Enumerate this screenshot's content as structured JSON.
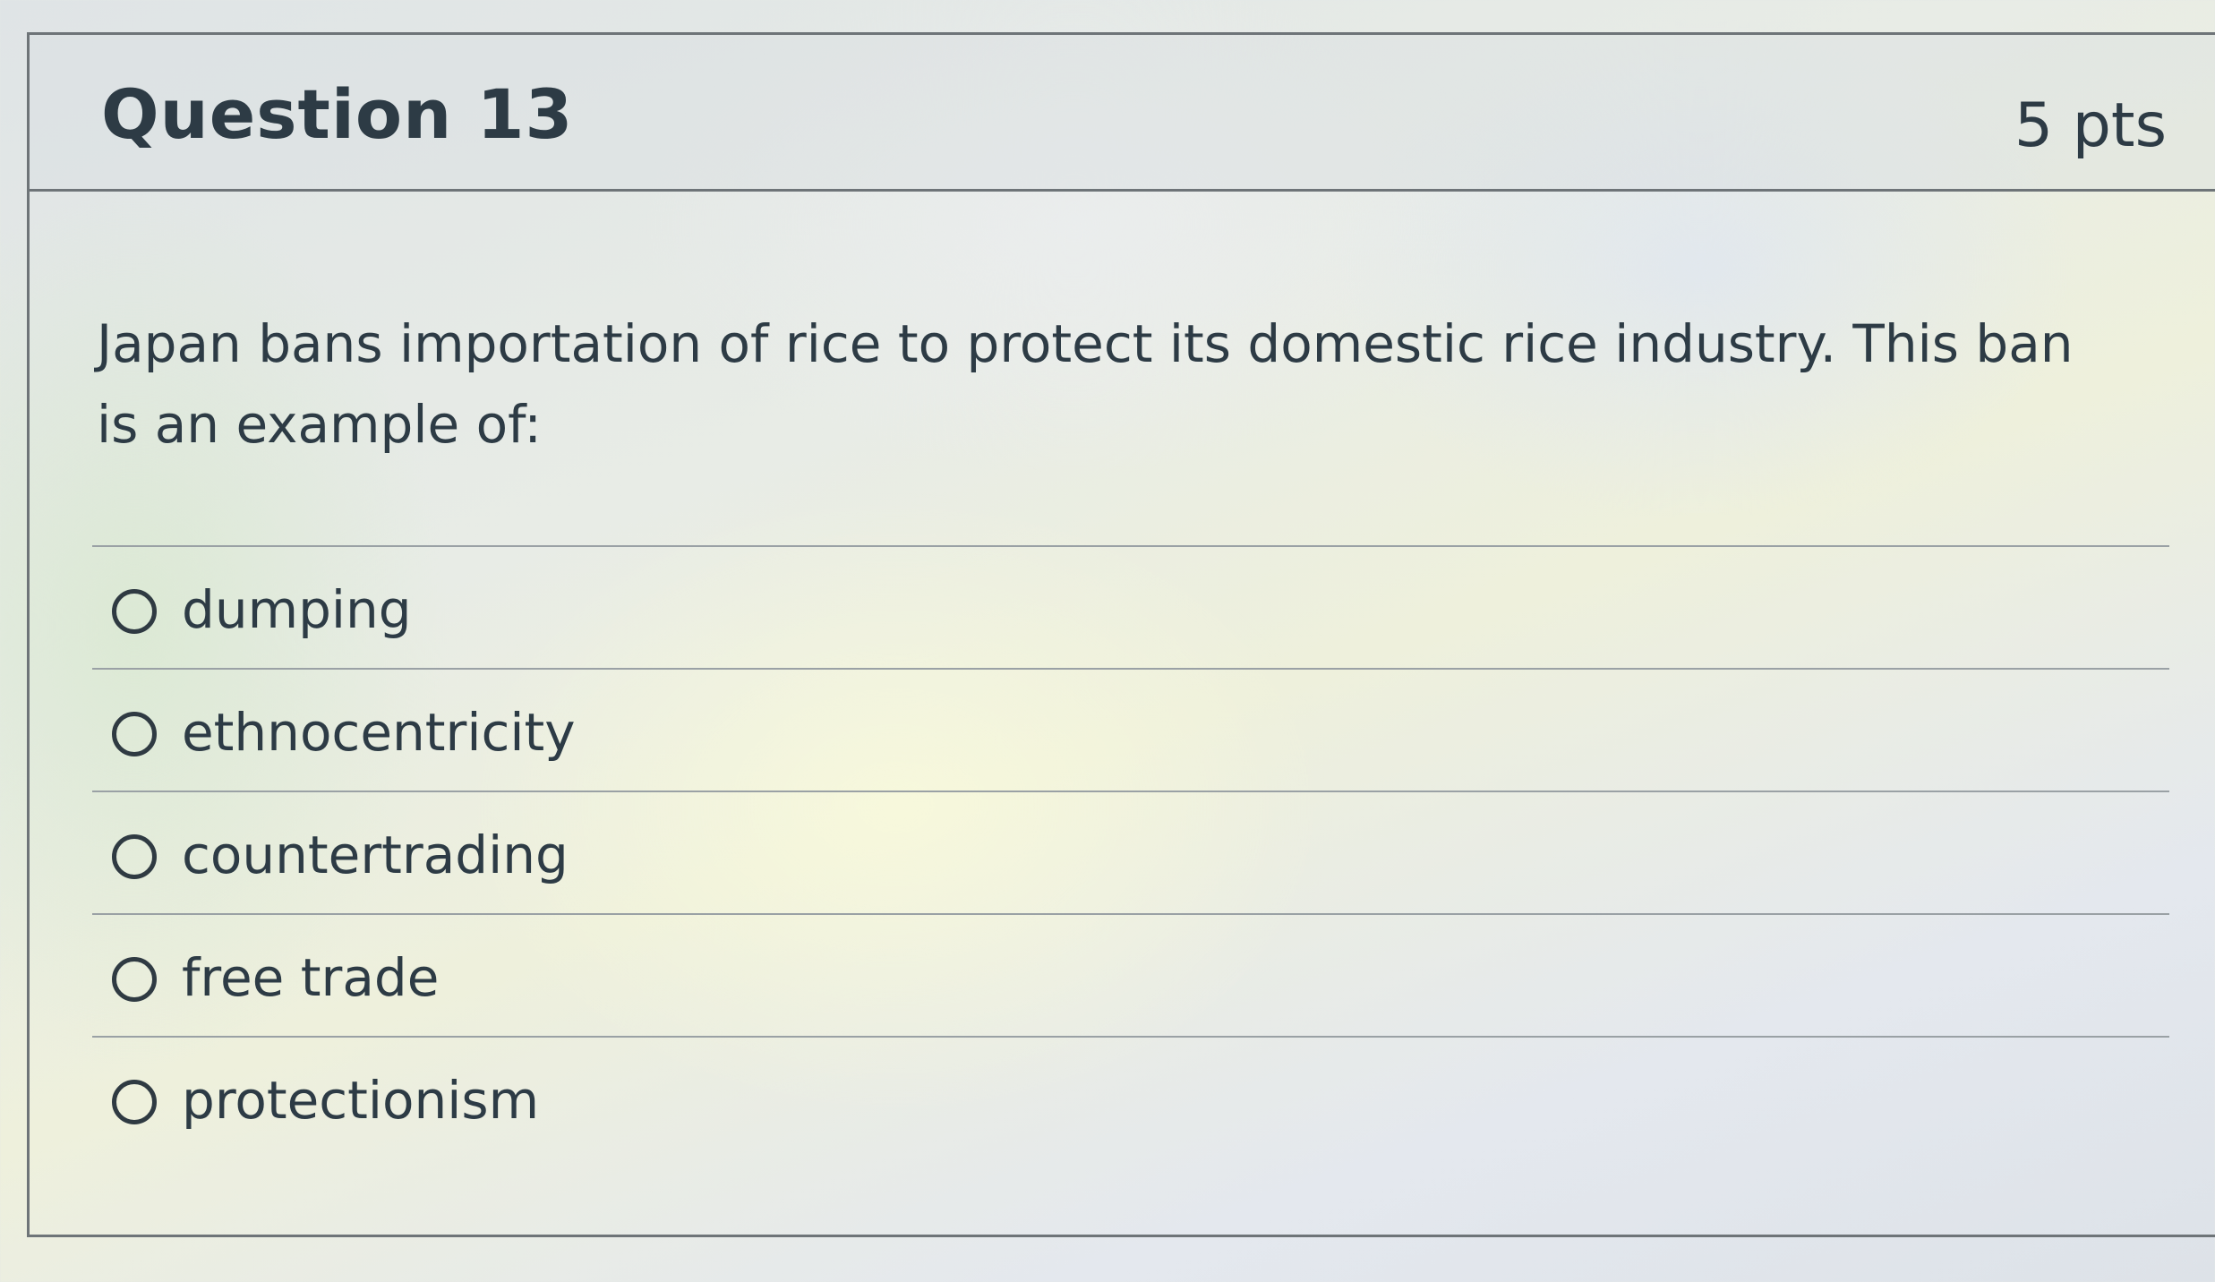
{
  "question": {
    "title": "Question 13",
    "points": "5 pts",
    "text": "Japan bans importation of rice to protect its domestic rice industry. This ban is an example of:"
  },
  "answers": [
    {
      "label": "dumping",
      "selected": false
    },
    {
      "label": "ethnocentricity",
      "selected": false
    },
    {
      "label": "countertrading",
      "selected": false
    },
    {
      "label": "free trade",
      "selected": false
    },
    {
      "label": "protectionism",
      "selected": false
    }
  ]
}
